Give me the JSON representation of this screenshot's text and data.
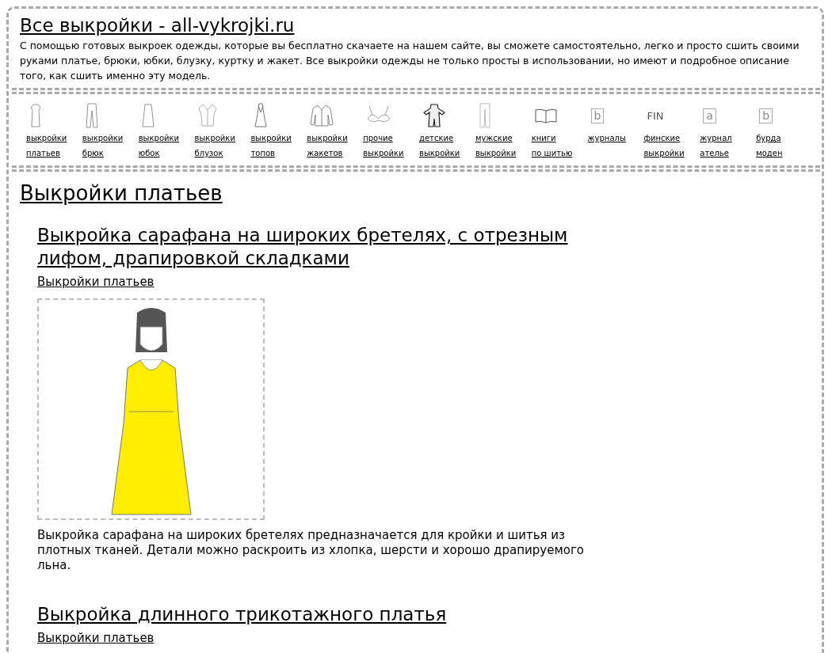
{
  "site": {
    "title": "Все выкройки - all-vykrojki.ru",
    "description": "С помощью готовых выкроек одежды, которые вы бесплатно скачаете на нашем сайте, вы сможете самостоятельно, легко и просто сшить своими руками платье, брюки, юбки, блузку, куртку и жакет. Все выкройки одежды не только просты в использовании, но имеют и подробное описание того, как сшить именно эту модель."
  },
  "nav": [
    {
      "kind": "dress",
      "label": [
        "выкройки",
        "платьев"
      ]
    },
    {
      "kind": "trousers",
      "label": [
        "выкройки",
        "брюк"
      ]
    },
    {
      "kind": "skirt",
      "label": [
        "выкройки",
        "юбок"
      ]
    },
    {
      "kind": "blouse",
      "label": [
        "выкройки",
        "блузок"
      ]
    },
    {
      "kind": "top",
      "label": [
        "выкройки",
        "топов"
      ]
    },
    {
      "kind": "jacket",
      "label": [
        "выкройки",
        "жакетов"
      ]
    },
    {
      "kind": "bra",
      "label": [
        "прочие",
        "выкройки"
      ]
    },
    {
      "kind": "kids",
      "label": [
        "детские",
        "выкройки"
      ]
    },
    {
      "kind": "mens",
      "label": [
        "мужские",
        "выкройки"
      ]
    },
    {
      "kind": "book",
      "label": [
        "книги",
        "по шитью"
      ]
    },
    {
      "kind": "magazine",
      "icon_text": "b",
      "label": [
        "журналы"
      ]
    },
    {
      "kind": "text",
      "icon_text": "FIN",
      "label": [
        "финские",
        "выкройки"
      ]
    },
    {
      "kind": "magazine",
      "icon_text": "a",
      "label": [
        "журнал",
        "ателье"
      ]
    },
    {
      "kind": "magazine",
      "icon_text": "b",
      "label": [
        "бурда",
        "моден"
      ]
    }
  ],
  "section": {
    "title": "Выкройки платьев"
  },
  "articles": [
    {
      "title": "Выкройка сарафана на широких бретелях, с отрезным лифом, драпировкой складками",
      "category": "Выкройки платьев",
      "has_image": true,
      "text": "Выкройка сарафана на широких бретелях предназначается для кройки и шитья из плотных тканей. Детали можно раскроить из хлопка, шерсти и хорошо драпируемого льна."
    },
    {
      "title": "Выкройка длинного трикотажного платья",
      "category": "Выкройки платьев",
      "has_image": false
    }
  ]
}
